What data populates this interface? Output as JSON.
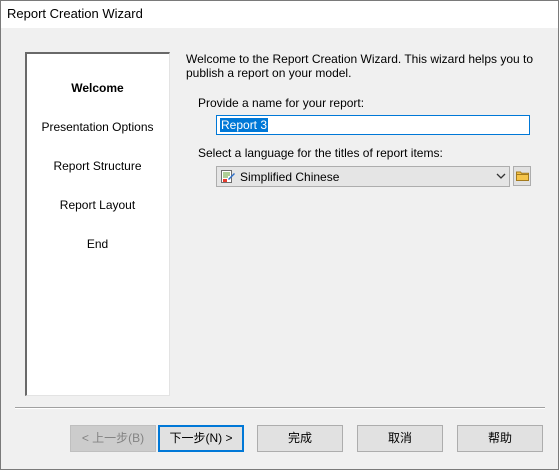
{
  "window": {
    "title": "Report Creation Wizard"
  },
  "sidebar": {
    "items": [
      {
        "label": "Welcome",
        "active": true
      },
      {
        "label": "Presentation Options",
        "active": false
      },
      {
        "label": "Report Structure",
        "active": false
      },
      {
        "label": "Report Layout",
        "active": false
      },
      {
        "label": "End",
        "active": false
      }
    ]
  },
  "main": {
    "intro": "Welcome to the Report Creation Wizard. This wizard helps you to publish a report on your model.",
    "name_label": "Provide a name for your report:",
    "name_value": "Report 3",
    "language_label": "Select a language for the titles of report items:",
    "language_value": "Simplified Chinese",
    "language_icon": "language-icon",
    "browse_icon": "folder-icon"
  },
  "buttons": {
    "back": "< 上一步(B)",
    "next": "下一步(N) >",
    "finish": "完成",
    "cancel": "取消",
    "help": "帮助"
  },
  "colors": {
    "accent": "#0078d7",
    "dialog_bg": "#f0f0f0"
  }
}
